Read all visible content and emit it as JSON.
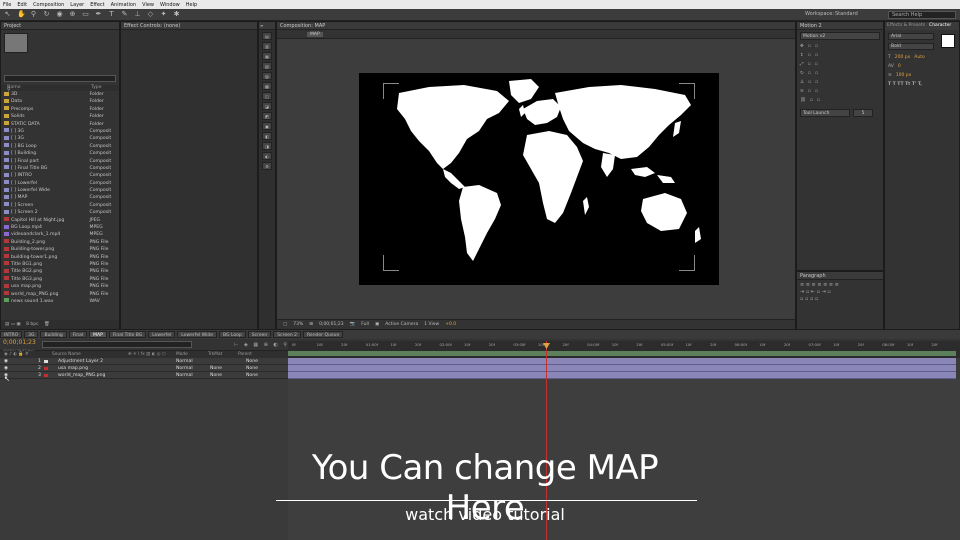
{
  "menu": {
    "items": [
      "File",
      "Edit",
      "Composition",
      "Layer",
      "Effect",
      "Animation",
      "View",
      "Window",
      "Help"
    ]
  },
  "toolbar": {
    "workspace_label": "Workspace:",
    "workspace_value": "Standard",
    "search_placeholder": "Search Help"
  },
  "project": {
    "tab": "Project",
    "col_name": "Name",
    "col_type": "Type",
    "files": [
      {
        "name": "3D",
        "type": "Folder",
        "kind": "folder"
      },
      {
        "name": "Data",
        "type": "Folder",
        "kind": "folder"
      },
      {
        "name": "Precomps",
        "type": "Folder",
        "kind": "folder"
      },
      {
        "name": "Solids",
        "type": "Folder",
        "kind": "folder"
      },
      {
        "name": "STATIC DATA",
        "type": "Folder",
        "kind": "folder"
      },
      {
        "name": "[ ] 3G",
        "type": "Composit",
        "kind": "comp"
      },
      {
        "name": "[ ] 3G",
        "type": "Composit",
        "kind": "comp"
      },
      {
        "name": "[ ] BG Loop",
        "type": "Composit",
        "kind": "comp"
      },
      {
        "name": "[ ] Building",
        "type": "Composit",
        "kind": "comp"
      },
      {
        "name": "[ ] Final part",
        "type": "Composit",
        "kind": "comp"
      },
      {
        "name": "[ ] Final Title BG",
        "type": "Composit",
        "kind": "comp"
      },
      {
        "name": "[ ] INTRO",
        "type": "Composit",
        "kind": "comp"
      },
      {
        "name": "[ ] Lowerfel",
        "type": "Composit",
        "kind": "comp"
      },
      {
        "name": "[ ] Lowerfel Wide",
        "type": "Composit",
        "kind": "comp"
      },
      {
        "name": "[ ] MAP",
        "type": "Composit",
        "kind": "comp"
      },
      {
        "name": "[ ] Screen",
        "type": "Composit",
        "kind": "comp"
      },
      {
        "name": "[ ] Screen 2",
        "type": "Composit",
        "kind": "comp"
      },
      {
        "name": "Capitol Hill at Night.jpg",
        "type": "JPEG",
        "kind": "image"
      },
      {
        "name": "BG Loop.mp4",
        "type": "MPEG",
        "kind": "video"
      },
      {
        "name": "videoandclark_1.mp4",
        "type": "MPEG",
        "kind": "video"
      },
      {
        "name": "Building_2.png",
        "type": "PNG File",
        "kind": "image"
      },
      {
        "name": "Building-tower.png",
        "type": "PNG File",
        "kind": "image"
      },
      {
        "name": "building-tower1.png",
        "type": "PNG File",
        "kind": "image"
      },
      {
        "name": "Title BG1.png",
        "type": "PNG File",
        "kind": "image"
      },
      {
        "name": "Title BG2.png",
        "type": "PNG File",
        "kind": "image"
      },
      {
        "name": "Title BG3.png",
        "type": "PNG File",
        "kind": "image"
      },
      {
        "name": "usa map.png",
        "type": "PNG File",
        "kind": "image"
      },
      {
        "name": "world_map_PNG.png",
        "type": "PNG File",
        "kind": "image"
      },
      {
        "name": "news sound 1.wav",
        "type": "WAV",
        "kind": "audio"
      }
    ],
    "footer_bpc": "8 bpc"
  },
  "effect_controls": {
    "tab": "Effect Controls: (none)"
  },
  "composition": {
    "tab": "Composition: MAP",
    "breadcrumb": "MAP",
    "zoom": "73%",
    "timecode": "0;00;01;23",
    "quality": "Full",
    "camera": "Active Camera",
    "view": "1 View",
    "offset": "+0.0"
  },
  "info_panel": {
    "tab": "Motion 2",
    "preset": "Motion v2",
    "dropdown": "Tool Launch",
    "dropdown_value": "5"
  },
  "paragraph_panel": {
    "tab": "Paragraph"
  },
  "character_panel": {
    "tabs": [
      "Effects & Presets",
      "Character"
    ],
    "font": "Arial",
    "style": "Bold",
    "size": "200 px",
    "leading": "Auto",
    "tracking": "0",
    "stroke": "100 px"
  },
  "timeline": {
    "tabs": [
      "INTRO",
      "3G",
      "Building",
      "Final",
      "MAP",
      "Final Title BG",
      "Lowerfel",
      "Lowerfel Wide",
      "BG Loop",
      "Screen",
      "Screen 2",
      "Render Queue"
    ],
    "active_tab": "MAP",
    "timecode": "0;00;01;23",
    "fps": "00053 (29.97 fps)",
    "columns": {
      "source": "Source Name",
      "mode": "Mode",
      "trkmat": "TrkMat",
      "parent": "Parent"
    },
    "layers": [
      {
        "num": "1",
        "name": "Adjustment Layer 2",
        "mode": "Normal",
        "trkmat": "",
        "parent": "None",
        "color": "#dddddd"
      },
      {
        "num": "2",
        "name": "usa map.png",
        "mode": "Normal",
        "trkmat": "None",
        "parent": "None",
        "color": "#c03030"
      },
      {
        "num": "3",
        "name": "world_map_PNG.png",
        "mode": "Normal",
        "trkmat": "None",
        "parent": "None",
        "color": "#c03030"
      }
    ],
    "ruler": [
      "0f",
      "10f",
      "20f",
      "01:00f",
      "10f",
      "20f",
      "02:00f",
      "10f",
      "20f",
      "03:00f",
      "10f",
      "20f",
      "04:00f",
      "10f",
      "20f",
      "05:00f",
      "10f",
      "20f",
      "06:00f",
      "10f",
      "20f",
      "07:00f",
      "10f",
      "20f",
      "08:00f",
      "10f",
      "20f"
    ]
  },
  "overlay": {
    "title": "You Can change MAP Here",
    "subtitle": "watch video tutorial"
  }
}
